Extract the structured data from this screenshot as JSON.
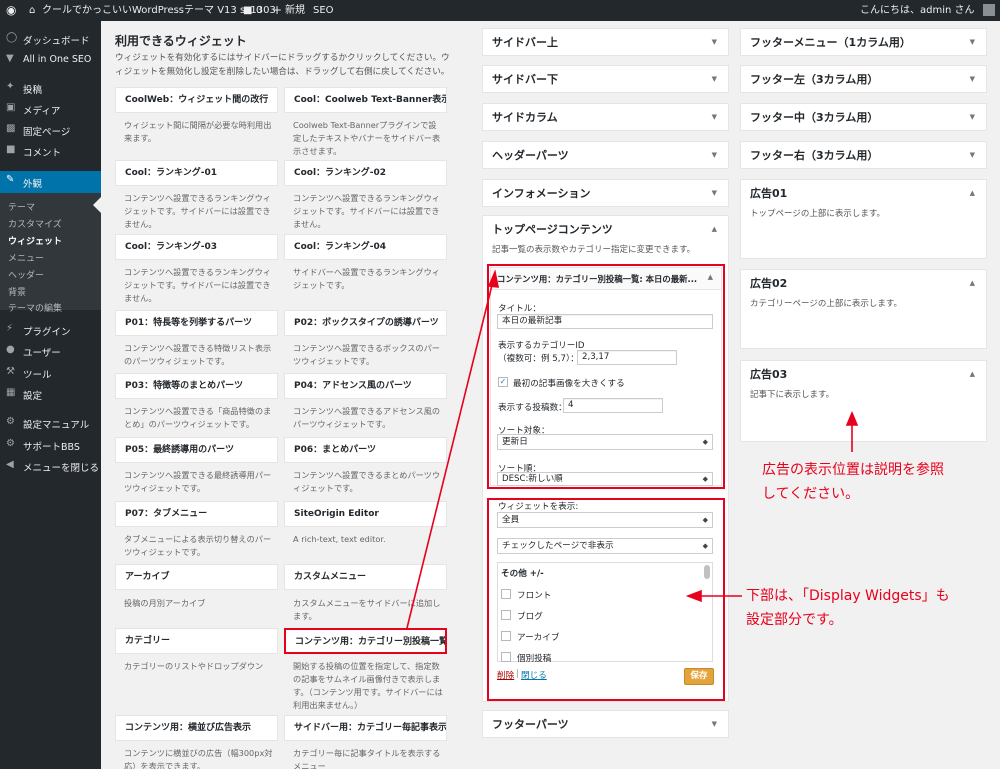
{
  "adminbar": {
    "site_title": "クールでかっこいいWordPressテーマ V13 ss1303",
    "comments_count": "0",
    "new_label": "新規",
    "seo_label": "SEO",
    "greeting": "こんにちは、admin さん"
  },
  "sidebar": {
    "items": [
      {
        "label": "ダッシュボード",
        "icon": "dashboard-icon"
      },
      {
        "label": "All in One SEO",
        "icon": "shield-icon"
      },
      {
        "label": "投稿",
        "icon": "pin-icon"
      },
      {
        "label": "メディア",
        "icon": "media-icon"
      },
      {
        "label": "固定ページ",
        "icon": "page-icon"
      },
      {
        "label": "コメント",
        "icon": "comment-icon"
      },
      {
        "label": "外観",
        "icon": "brush-icon"
      },
      {
        "label": "プラグイン",
        "icon": "plugin-icon"
      },
      {
        "label": "ユーザー",
        "icon": "user-icon"
      },
      {
        "label": "ツール",
        "icon": "wrench-icon"
      },
      {
        "label": "設定",
        "icon": "settings-icon"
      },
      {
        "label": "設定マニュアル",
        "icon": "book-icon"
      },
      {
        "label": "サポートBBS",
        "icon": "gear-icon"
      },
      {
        "label": "メニューを閉じる",
        "icon": "collapse-icon"
      }
    ],
    "submenu": [
      "テーマ",
      "カスタマイズ",
      "ウィジェット",
      "メニュー",
      "ヘッダー",
      "背景",
      "テーマの編集"
    ]
  },
  "available": {
    "title": "利用できるウィジェット",
    "description": "ウィジェットを有効化するにはサイドバーにドラッグするかクリックしてください。ウィジェットを無効化し設定を削除したい場合は、ドラッグして右側に戻してください。",
    "widgets": [
      {
        "name": "CoolWeb：ウィジェット間の改行",
        "desc": "ウィジェット間に間隔が必要な時利用出来ます。"
      },
      {
        "name": "Cool：Coolweb Text-Banner表示",
        "desc": "Coolweb Text-Bannerプラグインで設定したテキストやバナーをサイドバー表示させます。"
      },
      {
        "name": "Cool：ランキング-01",
        "desc": "コンテンツへ設置できるランキングウィジェットです。サイドバーには設置できません。"
      },
      {
        "name": "Cool：ランキング-02",
        "desc": "コンテンツへ設置できるランキングウィジェットです。サイドバーには設置できません。"
      },
      {
        "name": "Cool：ランキング-03",
        "desc": "コンテンツへ設置できるランキングウィジェットです。サイドバーには設置できません。"
      },
      {
        "name": "Cool：ランキング-04",
        "desc": "サイドバーへ設置できるランキングウィジェットです。"
      },
      {
        "name": "P01：特長等を列挙するパーツ",
        "desc": "コンテンツへ設置できる特徴リスト表示のパーツウィジェットです。"
      },
      {
        "name": "P02：ボックスタイプの誘導パーツ",
        "desc": "コンテンツへ設置できるボックスのパーツウィジェットです。"
      },
      {
        "name": "P03：特徴等のまとめパーツ",
        "desc": "コンテンツへ設置できる「商品特徴のまとめ」のパーツウィジェットです。"
      },
      {
        "name": "P04：アドセンス風のパーツ",
        "desc": "コンテンツへ設置できるアドセンス風のパーツウィジェットです。"
      },
      {
        "name": "P05：最終誘導用のパーツ",
        "desc": "コンテンツへ設置できる最終誘導用パーツウィジェットです。"
      },
      {
        "name": "P06：まとめパーツ",
        "desc": "コンテンツへ設置できるまとめパーツウィジェットです。"
      },
      {
        "name": "P07：タブメニュー",
        "desc": "タブメニューによる表示切り替えのパーツウィジェットです。"
      },
      {
        "name": "SiteOrigin Editor",
        "desc": "A rich-text, text editor."
      },
      {
        "name": "アーカイブ",
        "desc": "投稿の月別アーカイブ"
      },
      {
        "name": "カスタムメニュー",
        "desc": "カスタムメニューをサイドバーに追加します。"
      },
      {
        "name": "カテゴリー",
        "desc": "カテゴリーのリストやドロップダウン"
      },
      {
        "name": "コンテンツ用：カテゴリー別投稿一覧",
        "desc": "開始する投稿の位置を指定して、指定数の記事をサムネイル画像付きで表示します。（コンテンツ用です。サイドバーには利用出来ません。）"
      },
      {
        "name": "コンテンツ用：横並び広告表示",
        "desc": "コンテンツに横並びの広告（幅300px対応）を表示できます。"
      },
      {
        "name": "サイドバー用：カテゴリー毎記事表示",
        "desc": "カテゴリー毎に記事タイトルを表示するメニュー"
      }
    ]
  },
  "middle": {
    "areas": [
      "サイドバー上",
      "サイドバー下",
      "サイドカラム",
      "ヘッダーパーツ",
      "インフォメーション"
    ],
    "top_content": {
      "title": "トップページコンテンツ",
      "desc": "記事一覧の表示数やカテゴリー指定に変更できます。"
    },
    "widget": {
      "title": "コンテンツ用：カテゴリー別投稿一覧: 本日の最新...",
      "title_label": "タイトル：",
      "title_value": "本日の最新記事",
      "cat_label": "表示するカテゴリーID",
      "cat_hint": "（複数可：例 5,7）：",
      "cat_value": "2,3,17",
      "bigimg_label": "最初の記事画像を大きくする",
      "count_label": "表示する投稿数：",
      "count_value": "4",
      "sort_target_label": "ソート対象：",
      "sort_target_value": "更新日",
      "sort_order_label": "ソート順：",
      "sort_order_value": "DESC:新しい順",
      "show_label": "ウィジェットを表示:",
      "show_value": "全員",
      "hide_value": "チェックしたページで非表示",
      "others_label": "その他 +/-",
      "pages": [
        "フロント",
        "ブログ",
        "アーカイブ",
        "個別投稿"
      ],
      "delete_label": "削除",
      "close_label": "閉じる",
      "save_label": "保存"
    },
    "footer_parts": "フッターパーツ"
  },
  "right": {
    "areas": [
      "フッターメニュー（1カラム用）",
      "フッター左（3カラム用）",
      "フッター中（3カラム用）",
      "フッター右（3カラム用）"
    ],
    "ads": [
      {
        "title": "広告01",
        "desc": "トップページの上部に表示します。"
      },
      {
        "title": "広告02",
        "desc": "カテゴリーページの上部に表示します。"
      },
      {
        "title": "広告03",
        "desc": "記事下に表示します。"
      }
    ]
  },
  "notes": {
    "ads_note_1": "広告の表示位置は説明を参照",
    "ads_note_2": "してください。",
    "dw_note_1": "下部は、「Display Widgets」も",
    "dw_note_2": "設定部分です。"
  },
  "colors": {
    "accent": "#0073aa",
    "annotation": "#e8001c",
    "save": "#e3a33b"
  }
}
